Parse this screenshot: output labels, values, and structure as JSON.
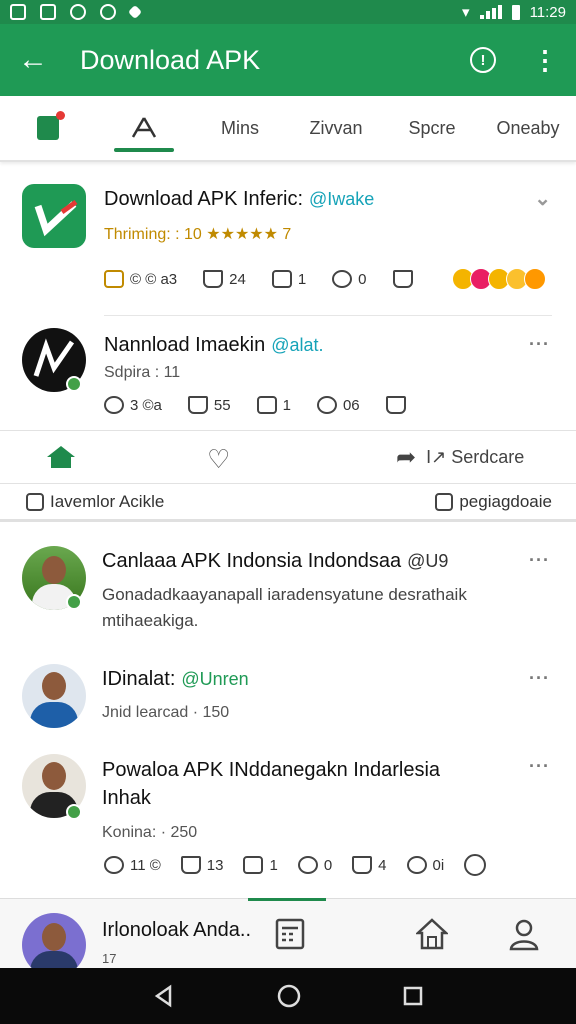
{
  "status_bar": {
    "time": "11:29"
  },
  "app_bar": {
    "title": "Download APK"
  },
  "tabs": [
    "",
    "",
    "Mins",
    "Zivvan",
    "Spcre",
    "Oneaby"
  ],
  "posts": [
    {
      "name": "Download APK Inferic:",
      "tag": "@Iwake",
      "sub": "Thriming: : 10 ★★★★★ 7",
      "actions": [
        "© © a3",
        "24",
        "1",
        "0",
        ""
      ]
    },
    {
      "name": "Nannload Imaekin",
      "tag": "@alat.",
      "sub": "Sdpira : 11",
      "actions": [
        "3 ©a",
        "55",
        "1",
        "06",
        ""
      ]
    }
  ],
  "post_nav": {
    "share_label": "I↗ Serdcare"
  },
  "link_row": {
    "left": "Iavemlor Acikle",
    "right": "pegiagdoaie"
  },
  "feed": [
    {
      "name": "Canlaaa APK Indonsia Indondsaa",
      "tag": "@U9",
      "body": "Gonadadkaayanapall iaradensyatune desrathaik mtihaeakiga."
    },
    {
      "name": "IDinalat:",
      "tag": "@Unren",
      "sub": "Jnid learcad · 150"
    },
    {
      "name": "Powaloa APK INddanegakn Indarlesia Inhak",
      "sub": "Konina: · 250",
      "actions": [
        "11 ©",
        "13",
        "1",
        "0",
        "4",
        "0i",
        ""
      ]
    },
    {
      "name": "Irlonoloak Anda..",
      "sub": "17"
    }
  ],
  "colors": {
    "primary": "#1f9a55",
    "accent": "#16a3b8",
    "star": "#f5b301"
  }
}
